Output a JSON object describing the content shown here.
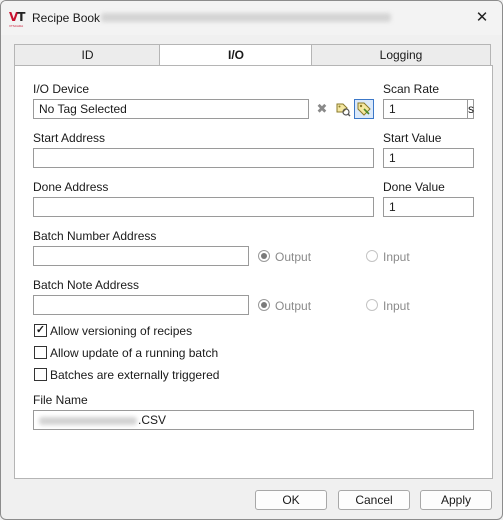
{
  "window": {
    "title": "Recipe Book"
  },
  "tabs": [
    {
      "label": "ID"
    },
    {
      "label": "I/O"
    },
    {
      "label": "Logging"
    }
  ],
  "io": {
    "io_device_label": "I/O Device",
    "io_device_value": "No Tag Selected",
    "scan_rate_label": "Scan Rate",
    "scan_rate_value": "1",
    "scan_rate_unit": "s",
    "start_address_label": "Start Address",
    "start_address_value": "",
    "start_value_label": "Start Value",
    "start_value_value": "1",
    "done_address_label": "Done Address",
    "done_address_value": "",
    "done_value_label": "Done Value",
    "done_value_value": "1",
    "batch_number_label": "Batch Number Address",
    "batch_number_value": "",
    "batch_note_label": "Batch Note Address",
    "batch_note_value": "",
    "output_label": "Output",
    "input_label": "Input",
    "allow_versioning_label": "Allow versioning of recipes",
    "allow_update_label": "Allow update of a running batch",
    "externally_triggered_label": "Batches are externally triggered",
    "file_name_label": "File Name",
    "file_name_ext": ".CSV"
  },
  "checkboxes": {
    "allow_versioning": true,
    "allow_update": false,
    "externally_triggered": false
  },
  "buttons": {
    "ok": "OK",
    "cancel": "Cancel",
    "apply": "Apply"
  },
  "icons": {
    "clear": "close-x-icon",
    "tag_browser": "tag-browse-icon",
    "tag_select": "tag-select-icon"
  }
}
